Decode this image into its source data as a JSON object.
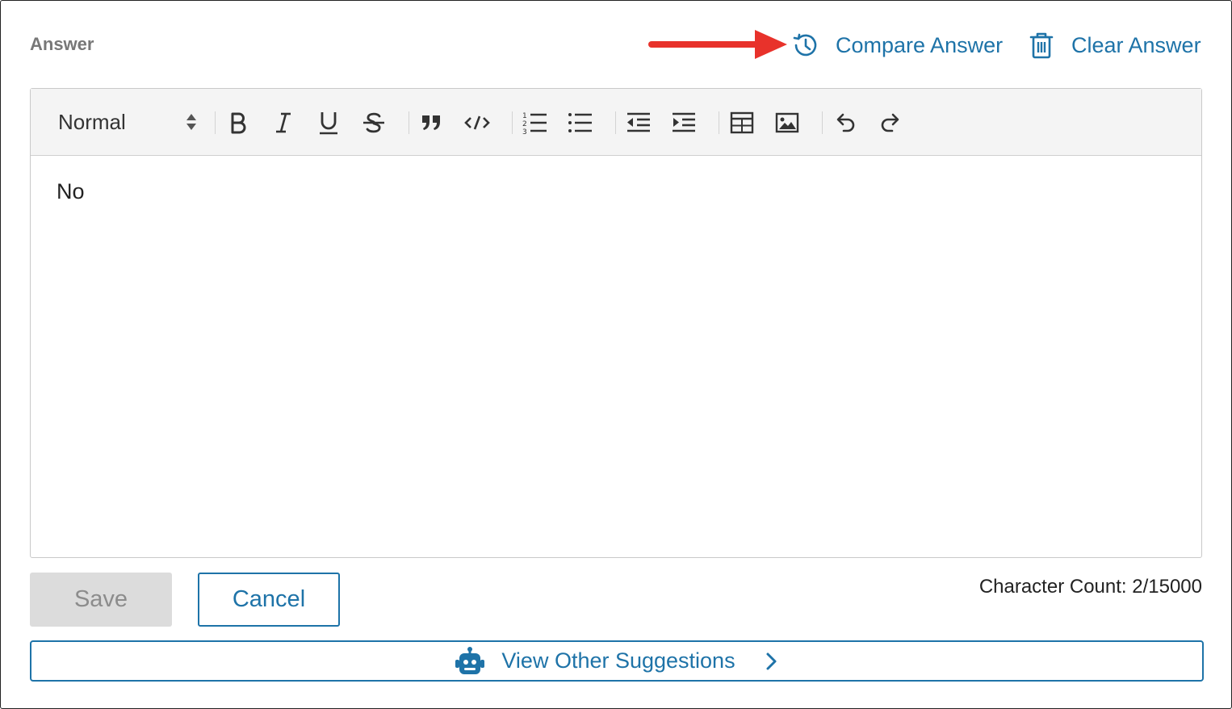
{
  "section": {
    "label": "Answer"
  },
  "actions": {
    "compare_label": "Compare Answer",
    "clear_label": "Clear Answer"
  },
  "toolbar": {
    "format_value": "Normal",
    "buttons": [
      "bold-icon",
      "italic-icon",
      "underline-icon",
      "strikethrough-icon",
      "quote-icon",
      "code-icon",
      "ordered-list-icon",
      "bullet-list-icon",
      "outdent-icon",
      "indent-icon",
      "table-icon",
      "image-icon",
      "undo-icon",
      "redo-icon"
    ]
  },
  "editor": {
    "text": "No"
  },
  "footer": {
    "save_label": "Save",
    "cancel_label": "Cancel",
    "char_count": "Character Count: 2/15000",
    "suggestions_label": "View Other Suggestions"
  },
  "colors": {
    "accent": "#1e73a8",
    "annotation_arrow": "#e8322b",
    "disabled_bg": "#dcdcdc"
  }
}
